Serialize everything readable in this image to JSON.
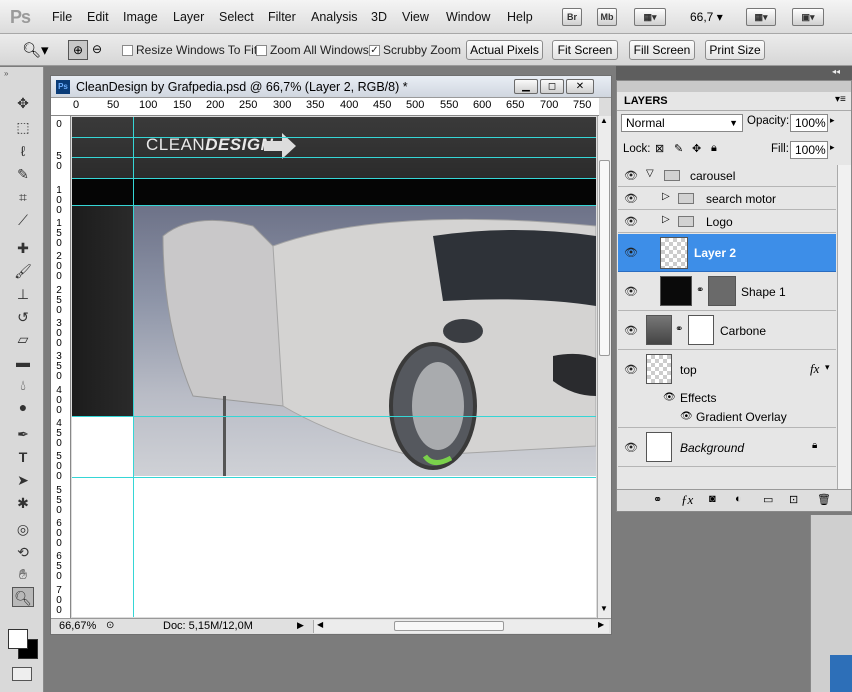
{
  "app": {
    "logo": "Ps"
  },
  "menu": [
    "File",
    "Edit",
    "Image",
    "Layer",
    "Select",
    "Filter",
    "Analysis",
    "3D",
    "View",
    "Window",
    "Help"
  ],
  "menubar_buttons": {
    "bridge": "Br",
    "minibridge": "Mb",
    "zoom_level": "66,7"
  },
  "options": {
    "resize_windows": {
      "label": "Resize Windows To Fit",
      "checked": false
    },
    "zoom_all_windows": {
      "label": "Zoom All Windows",
      "checked": false
    },
    "scrubby_zoom": {
      "label": "Scrubby Zoom",
      "checked": true
    },
    "buttons": [
      "Actual Pixels",
      "Fit Screen",
      "Fill Screen",
      "Print Size"
    ]
  },
  "document": {
    "title": "CleanDesign by Grafpedia.psd @ 66,7% (Layer 2, RGB/8) *",
    "ruler_h": [
      "0",
      "50",
      "100",
      "150",
      "200",
      "250",
      "300",
      "350",
      "400",
      "450",
      "500",
      "550",
      "600",
      "650",
      "700",
      "750"
    ],
    "ruler_v": [
      "0",
      "5 0",
      "1 0 0",
      "1 5 0",
      "2 0 0",
      "2 5 0",
      "3 0 0",
      "3 5 0",
      "4 0 0",
      "4 5 0",
      "5 0 0",
      "5 5 0",
      "6 0 0",
      "6 5 0",
      "7 0 0"
    ],
    "logo_light": "CLEAN",
    "logo_bold": "DESIGN",
    "status_zoom": "66,67%",
    "status_doc": "Doc: 5,15M/12,0M"
  },
  "layers_panel": {
    "tab": "LAYERS",
    "blend_mode": "Normal",
    "opacity_label": "Opacity:",
    "opacity": "100%",
    "lock_label": "Lock:",
    "fill_label": "Fill:",
    "fill": "100%",
    "layers": [
      {
        "name": "carousel"
      },
      {
        "name": "search motor"
      },
      {
        "name": "Logo"
      },
      {
        "name": "Layer 2"
      },
      {
        "name": "Shape 1"
      },
      {
        "name": "Carbone"
      },
      {
        "name": "top"
      },
      {
        "name": "Effects"
      },
      {
        "name": "Gradient Overlay"
      },
      {
        "name": "Background"
      }
    ],
    "fx_label": "fx"
  },
  "colors": {
    "selected_layer": "#3d8ee8",
    "guide": "#35d6d6",
    "window_bg": "#7c7c7c"
  },
  "icons": [
    "zoom-tool-icon",
    "eye-icon",
    "folder-icon",
    "lock-icon",
    "link-icon",
    "fx-icon",
    "trash-icon",
    "new-layer-icon",
    "mask-icon"
  ]
}
